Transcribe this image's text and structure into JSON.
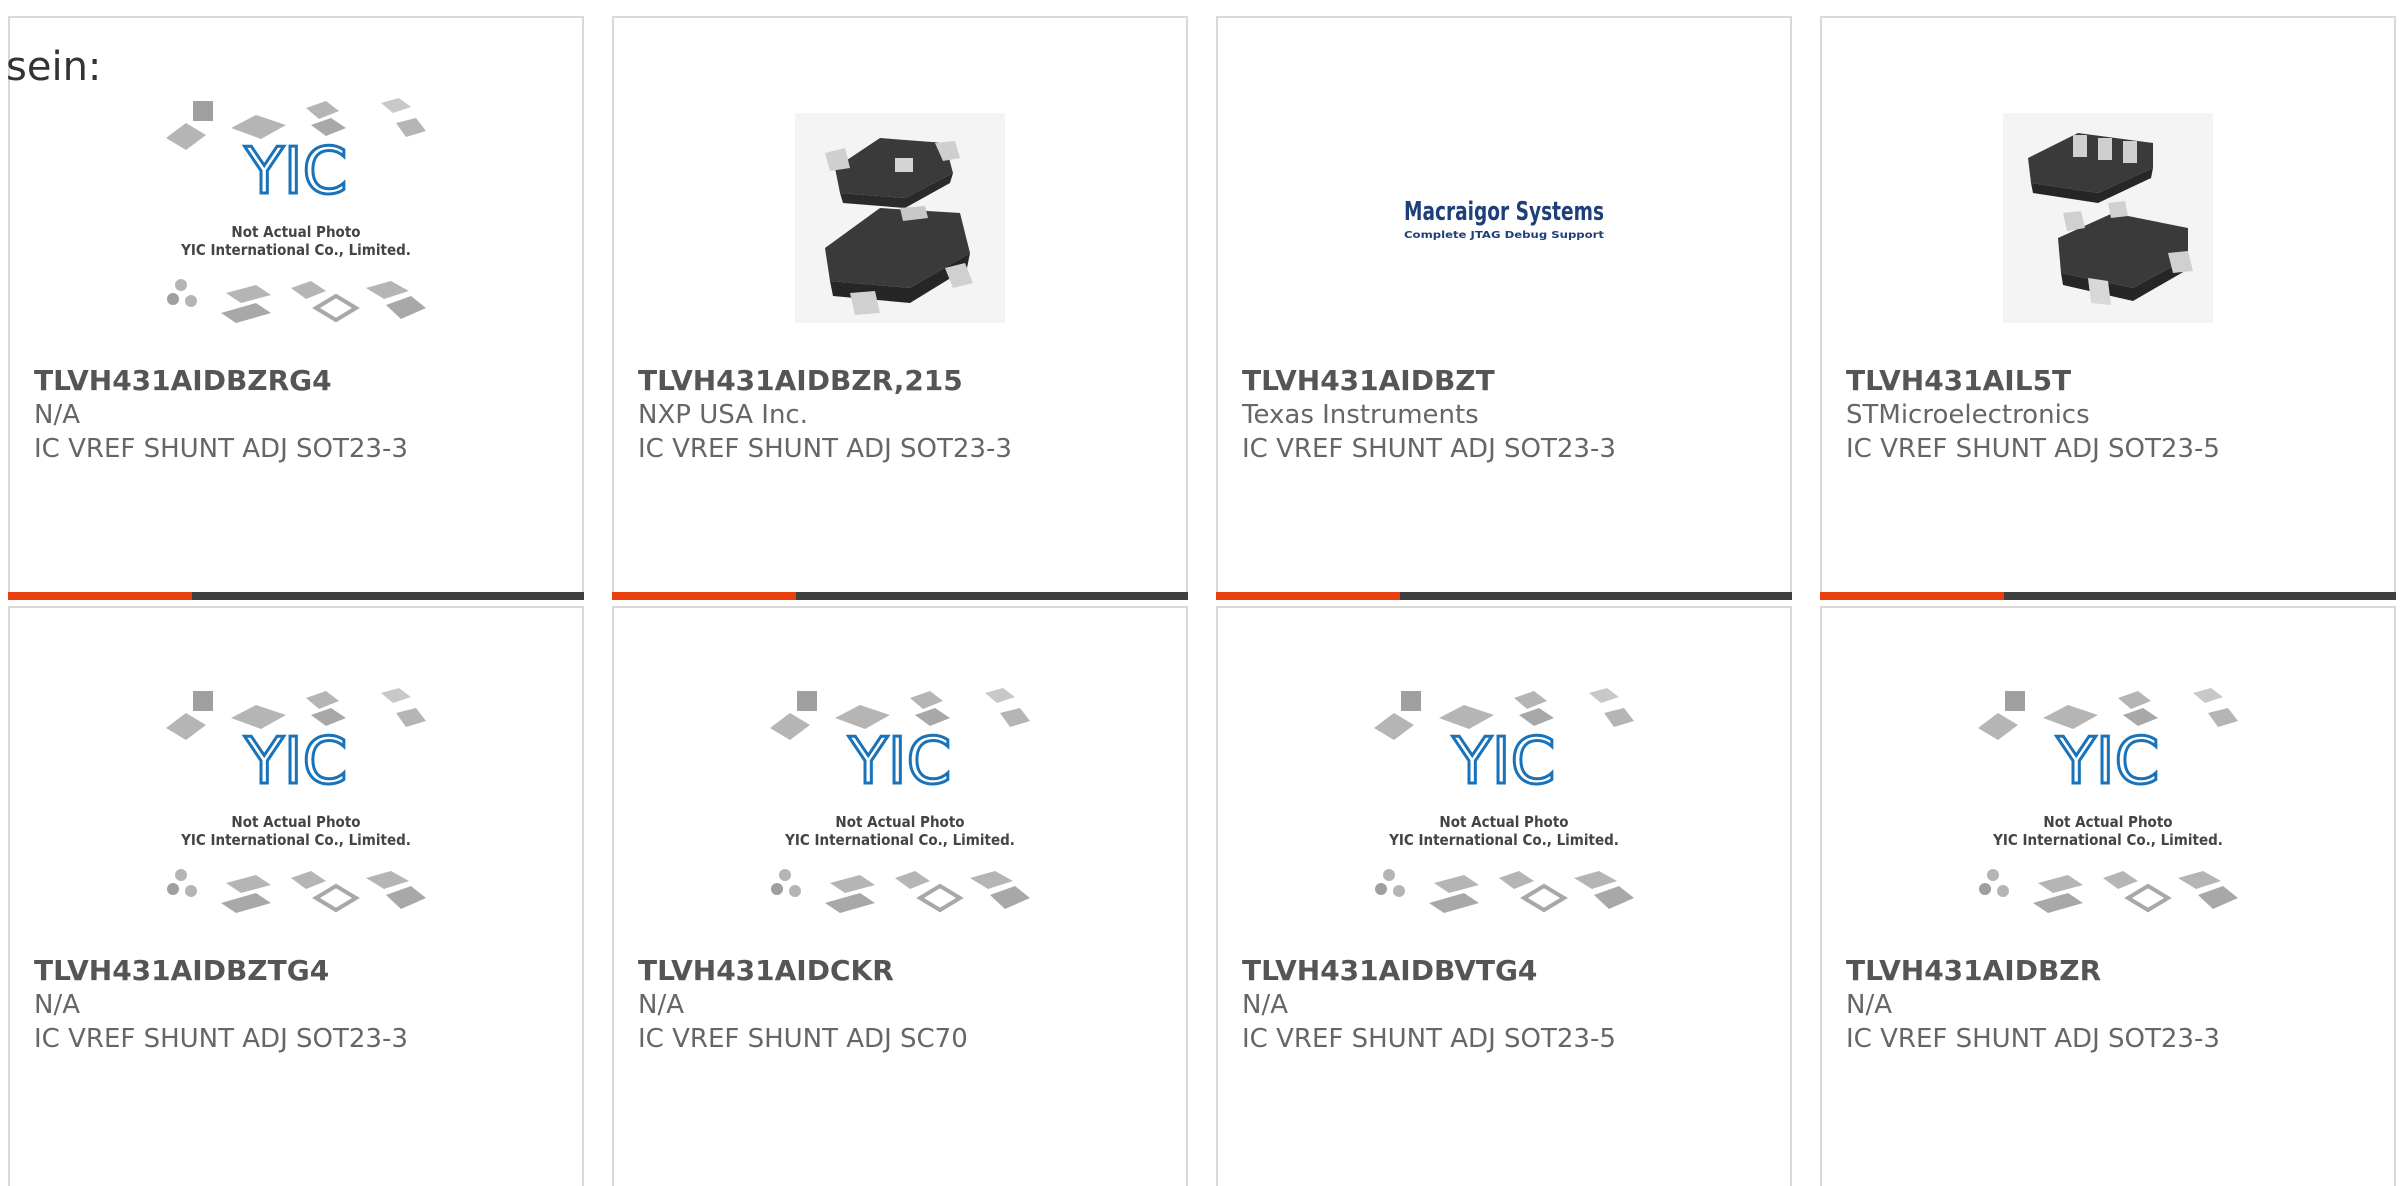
{
  "lead_text": "sein:",
  "products": [
    {
      "part_number": "TLVH431AIDBZRG4",
      "manufacturer": "N/A",
      "description": "IC VREF SHUNT ADJ SOT23-3",
      "image": "placeholder-logo"
    },
    {
      "part_number": "TLVH431AIDBZR,215",
      "manufacturer": "NXP USA Inc.",
      "description": "IC VREF SHUNT ADJ SOT23-3",
      "image": "sot23-3-package"
    },
    {
      "part_number": "TLVH431AIDBZT",
      "manufacturer": "Texas Instruments",
      "description": "IC VREF SHUNT ADJ SOT23-3",
      "image": "brand-logo"
    },
    {
      "part_number": "TLVH431AIL5T",
      "manufacturer": "STMicroelectronics",
      "description": "IC VREF SHUNT ADJ SOT23-5",
      "image": "sot23-5-package"
    },
    {
      "part_number": "TLVH431AIDBZTG4",
      "manufacturer": "N/A",
      "description": "IC VREF SHUNT ADJ SOT23-3",
      "image": "placeholder-logo"
    },
    {
      "part_number": "TLVH431AIDCKR",
      "manufacturer": "N/A",
      "description": "IC VREF SHUNT ADJ SC70",
      "image": "placeholder-logo"
    },
    {
      "part_number": "TLVH431AIDBVTG4",
      "manufacturer": "N/A",
      "description": "IC VREF SHUNT ADJ SOT23-5",
      "image": "placeholder-logo"
    },
    {
      "part_number": "TLVH431AIDBZR",
      "manufacturer": "N/A",
      "description": "IC VREF SHUNT ADJ SOT23-3",
      "image": "placeholder-logo"
    }
  ],
  "placeholder": {
    "logo_text": "YIC",
    "line1": "Not Actual Photo",
    "line2": "YIC International Co., Limited."
  },
  "brand_logo": {
    "name": "Macraigor Systems",
    "tagline": "Complete JTAG Debug Support"
  },
  "colors": {
    "accent": "#e8400f",
    "bar": "#404040",
    "border": "#d9d9d9",
    "text_bold": "#555555",
    "text": "#666666",
    "yic_blue": "#1a73b8",
    "brand_navy": "#1f3f7a"
  }
}
